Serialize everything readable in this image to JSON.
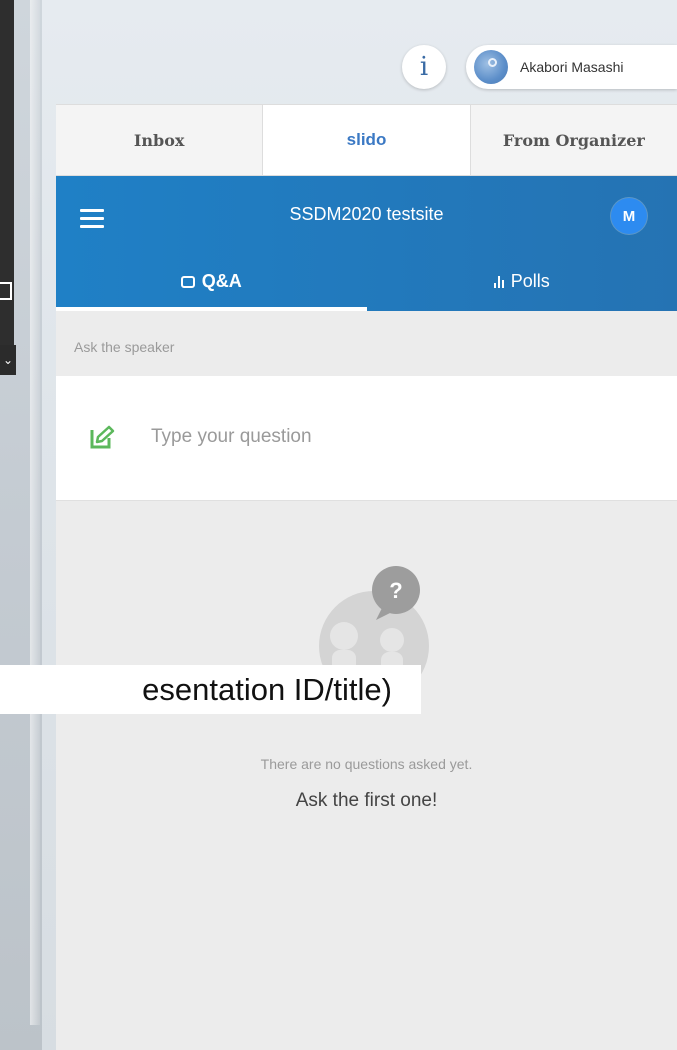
{
  "header_bar": {
    "info_icon": "info-icon",
    "user_name": "Akabori Masashi"
  },
  "top_tabs": [
    {
      "label": "Inbox",
      "active": false
    },
    {
      "label": "slido",
      "active": true
    },
    {
      "label": "From Organizer",
      "active": false
    }
  ],
  "slido": {
    "event_title": "SSDM2020 testsite",
    "avatar_initial": "M",
    "sub_tabs": [
      {
        "label": "Q&A",
        "icon": "chat-icon",
        "active": true
      },
      {
        "label": "Polls",
        "icon": "poll-bars-icon",
        "active": false
      }
    ],
    "ask_label": "Ask the speaker",
    "question_placeholder": "Type your question",
    "empty_text": "There are no questions asked yet.",
    "empty_cta": "Ask the first one!"
  },
  "overlay": {
    "caption": "esentation ID/title)"
  },
  "colors": {
    "header_blue": "#2573b3",
    "accent_blue": "#3b79c4",
    "avatar_blue": "#2d8bf0",
    "edit_green": "#5cb85c"
  }
}
